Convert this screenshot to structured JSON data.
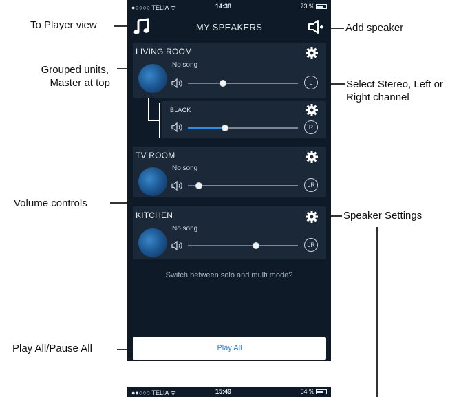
{
  "annotations": {
    "player_view": "To Player view",
    "grouped_line1": "Grouped units,",
    "grouped_line2": "Master at top",
    "volume": "Volume controls",
    "play_all": "Play All/Pause All",
    "add_speaker": "Add speaker",
    "channel_line1": "Select Stereo, Left or",
    "channel_line2": "Right channel",
    "settings": "Speaker Settings"
  },
  "status_bar": {
    "carrier": "●○○○○ TELIA ᯤ",
    "time": "14:38",
    "battery": "73 %"
  },
  "status_bar_2": {
    "carrier": "●●○○○ TELIA ᯤ",
    "time": "15:49",
    "battery": "64 %"
  },
  "header": {
    "title": "MY SPEAKERS",
    "left_icon": "music-note-icon",
    "right_icon": "add-speaker-icon"
  },
  "speakers": [
    {
      "name": "LIVING ROOM",
      "song": "No song",
      "volume": 0.32,
      "channel": "L"
    },
    {
      "name": "BLACK",
      "song": "",
      "volume": 0.34,
      "channel": "R"
    },
    {
      "name": "TV ROOM",
      "song": "No song",
      "volume": 0.1,
      "channel": "LR"
    },
    {
      "name": "KITCHEN",
      "song": "No song",
      "volume": 0.62,
      "channel": "LR"
    }
  ],
  "hint": "Switch between solo and multi mode?",
  "play_button": "Play All",
  "colors": {
    "background": "#0f1a28",
    "card": "#1a2838",
    "accent": "#2f8ee0",
    "button_text": "#2f7fcf"
  }
}
